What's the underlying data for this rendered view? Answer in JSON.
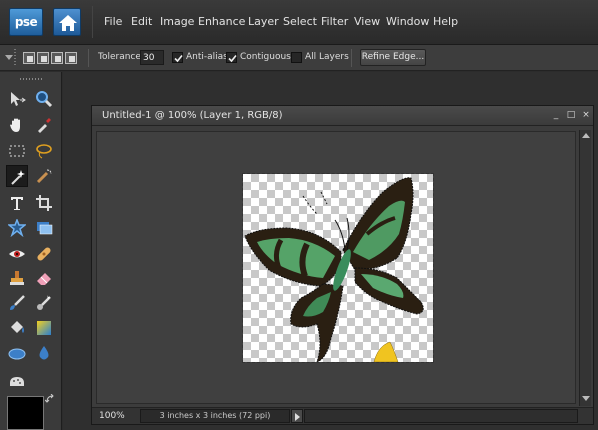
{
  "app": {
    "logo_text": "pse",
    "home_icon": "home-icon"
  },
  "menu": [
    "File",
    "Edit",
    "Image",
    "Enhance",
    "Layer",
    "Select",
    "Filter",
    "View",
    "Window",
    "Help"
  ],
  "options": {
    "tolerance_label": "Tolerance:",
    "tolerance_value": "30",
    "anti_alias": {
      "label": "Anti-alias",
      "checked": true
    },
    "contiguous": {
      "label": "Contiguous",
      "checked": true
    },
    "all_layers": {
      "label": "All Layers",
      "checked": false
    },
    "refine_edge": "Refine Edge..."
  },
  "tools": [
    "move-tool-icon",
    "zoom-tool-icon",
    "hand-tool-icon",
    "eyedropper-tool-icon",
    "rectangular-marquee-tool-icon",
    "lasso-tool-icon",
    "magic-wand-tool-icon",
    "quick-selection-tool-icon",
    "type-tool-icon",
    "crop-tool-icon",
    "cookie-cutter-tool-icon",
    "straighten-tool-icon",
    "red-eye-tool-icon",
    "spot-healing-tool-icon",
    "clone-stamp-tool-icon",
    "eraser-tool-icon",
    "brush-tool-icon",
    "smart-brush-tool-icon",
    "paint-bucket-tool-icon",
    "gradient-tool-icon",
    "shape-tool-icon",
    "blur-tool-icon",
    "sponge-tool-icon"
  ],
  "active_tool": "magic-wand-tool-icon",
  "colors": {
    "foreground": "#000000",
    "accent": "#2f6db5"
  },
  "document": {
    "title": "Untitled-1 @ 100% (Layer 1, RGB/8)",
    "minimize": "_",
    "maximize": "□",
    "close": "×",
    "zoom": "100%",
    "size_info": "3 inches x 3 inches (72 ppi)"
  }
}
